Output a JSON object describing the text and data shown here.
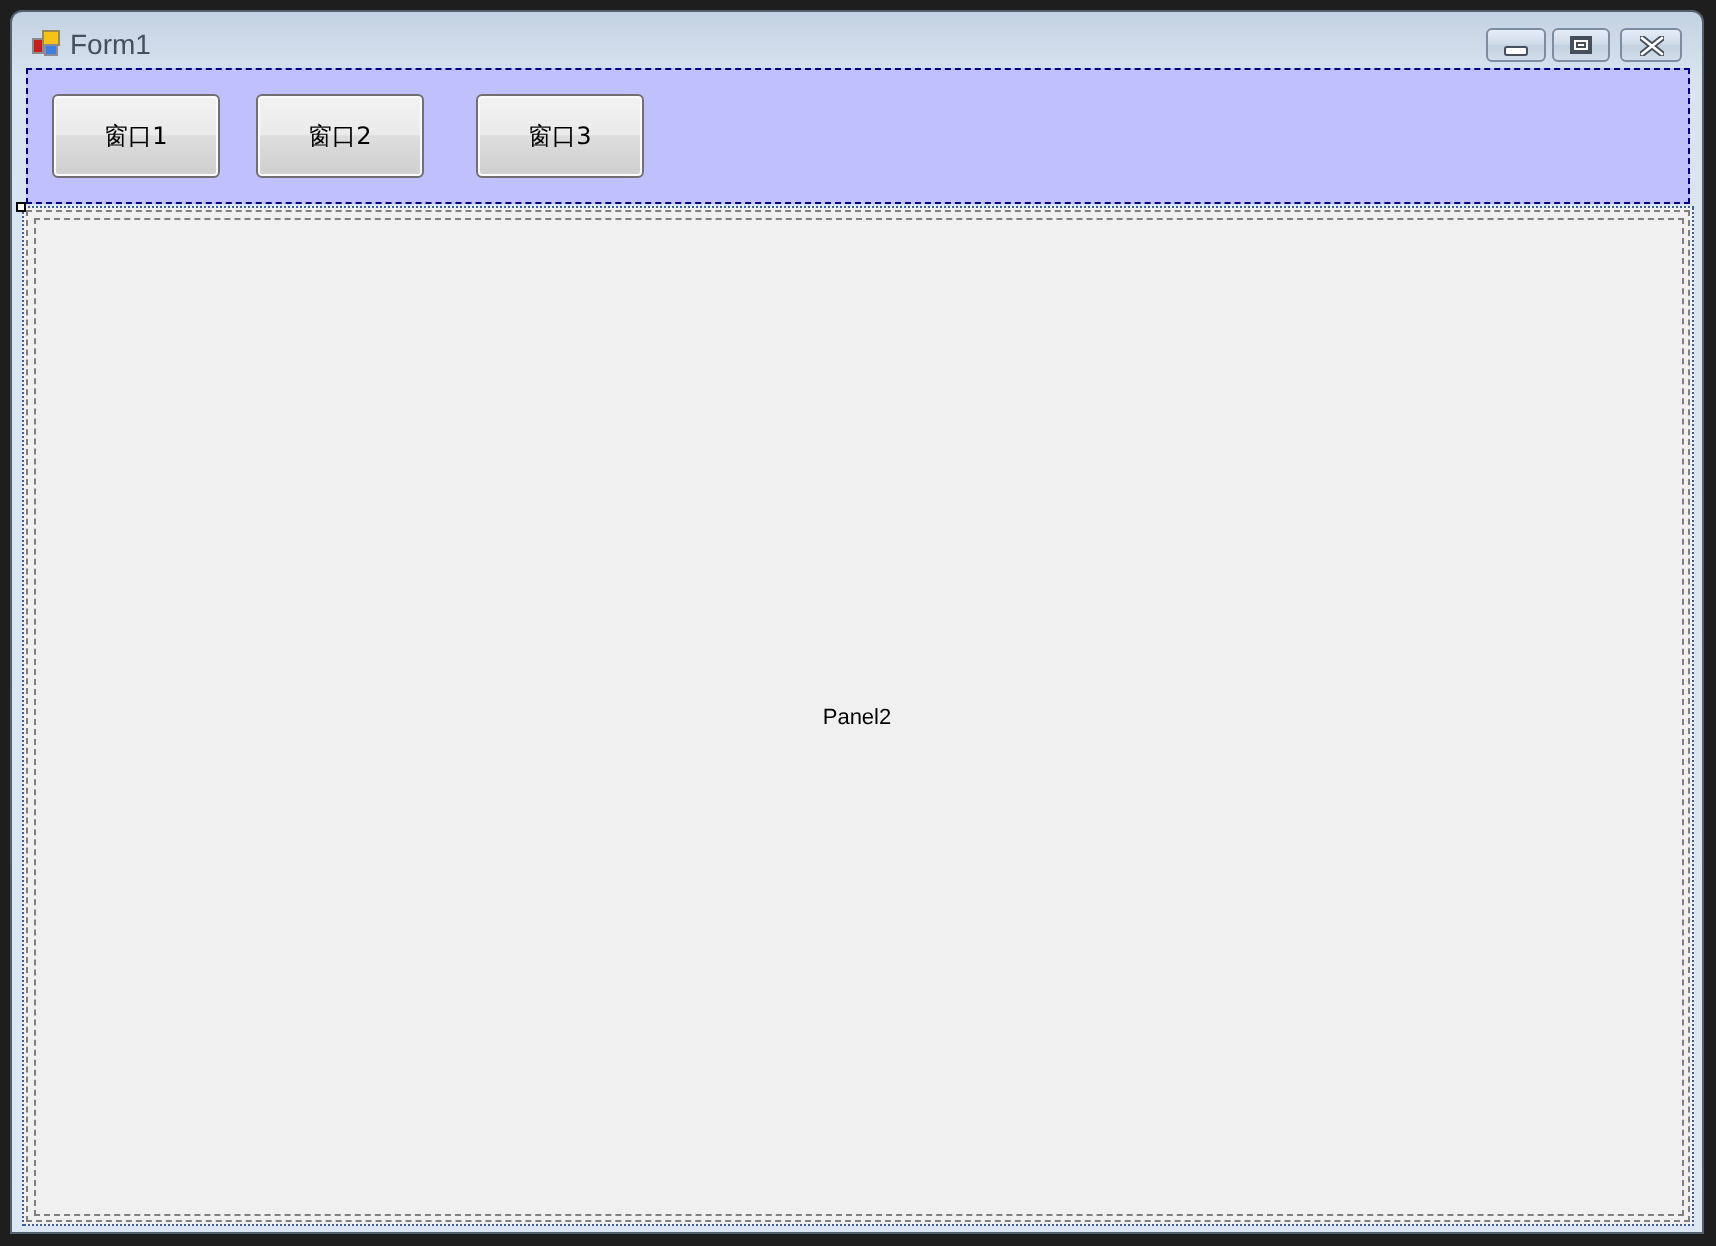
{
  "window": {
    "title": "Form1"
  },
  "panel1": {
    "buttons": [
      {
        "label": "窗口1"
      },
      {
        "label": "窗口2"
      },
      {
        "label": "窗口3"
      }
    ]
  },
  "panel2": {
    "label": "Panel2"
  }
}
